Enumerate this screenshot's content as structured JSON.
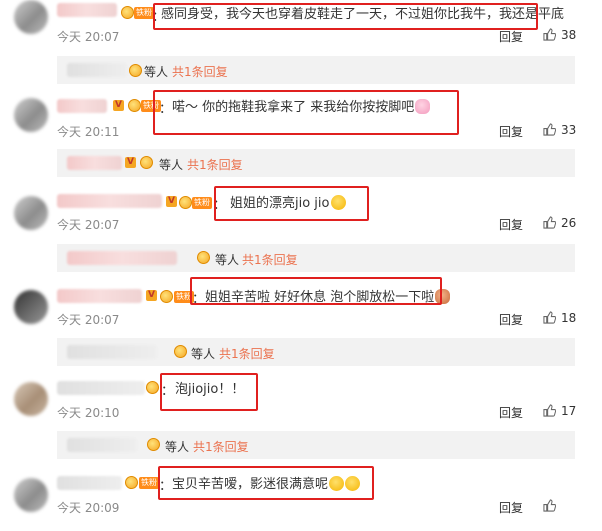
{
  "comments": [
    {
      "text": "感同身受，我今天也穿着皮鞋走了一天，不过姐你比我牛，我还是平底",
      "time": "今天 20:07",
      "reply": "回复",
      "likes": "38",
      "emoji": ""
    },
    {
      "text": "喏～ 你的拖鞋我拿来了 来我给你按按脚吧",
      "time": "今天 20:11",
      "reply": "回复",
      "likes": "33",
      "emoji": "pig-face-emoji"
    },
    {
      "text": "姐姐的漂亮jio jio",
      "time": "今天 20:07",
      "reply": "回复",
      "likes": "26",
      "emoji": "smile-emoji"
    },
    {
      "text": "姐姐辛苦啦 好好休息 泡个脚放松一下啦",
      "time": "今天 20:07",
      "reply": "回复",
      "likes": "18",
      "emoji": "bear-emoji"
    },
    {
      "text": "泡jiojio！！",
      "time": "今天 20:10",
      "reply": "回复",
      "likes": "17",
      "emoji": ""
    },
    {
      "text": "宝贝辛苦嗳，影迷很满意呢",
      "time": "今天 20:09",
      "reply": "回复",
      "likes": "",
      "emoji": "laugh-emoji"
    }
  ],
  "sub_threads": [
    {
      "prefix": "等人",
      "link": "共1条回复"
    },
    {
      "prefix": "等人",
      "link": "共1条回复"
    },
    {
      "prefix": "等人",
      "link": "共1条回复"
    },
    {
      "prefix": "等人",
      "link": "共1条回复"
    },
    {
      "prefix": "等人",
      "link": "共1条回复"
    }
  ],
  "badges": {
    "fan": "铁粉",
    "v": "V"
  },
  "colon": "："
}
